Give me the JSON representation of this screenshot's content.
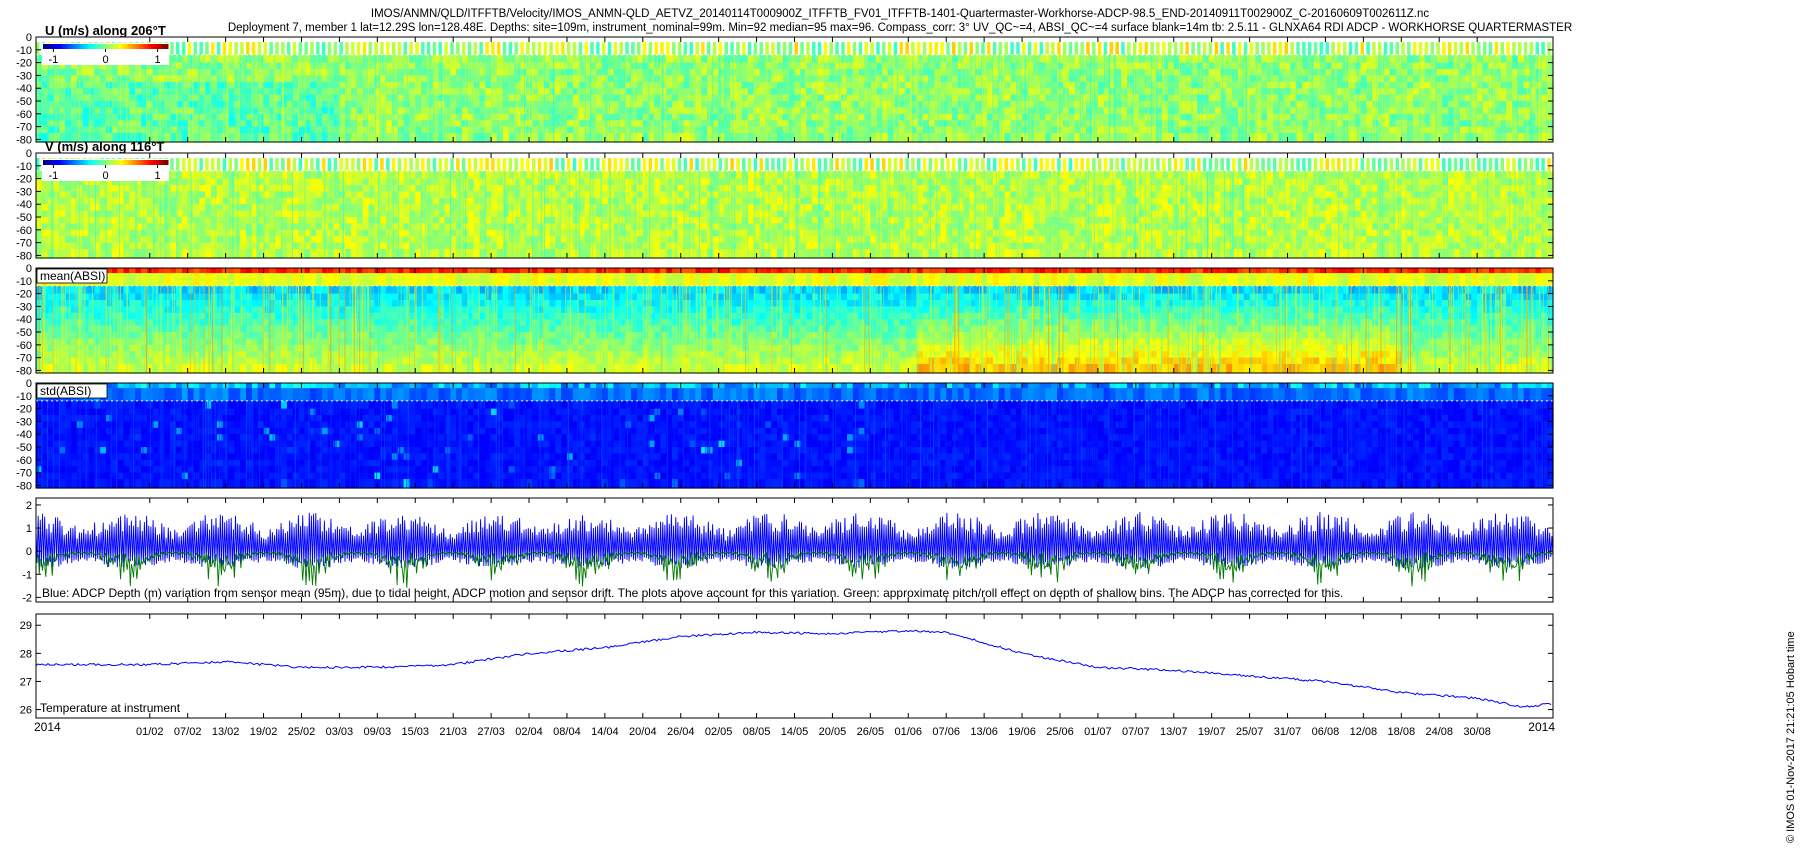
{
  "header": {
    "title_line1": "IMOS/ANMN/QLD/ITFFTB/Velocity/IMOS_ANMN-QLD_AETVZ_20140114T000900Z_ITFFTB_FV01_ITFFTB-1401-Quartermaster-Workhorse-ADCP-98.5_END-20140911T002900Z_C-20160609T002611Z.nc",
    "title_line2": "Deployment 7, member 1 lat=12.29S lon=128.48E. Depths: site=109m, instrument_nominal=99m. Min=92 median=95 max=96. Compass_corr: 3° UV_QC~=4, ABSI_QC~=4 surface blank=14m tb: 2.5.11 - GLNXA64 RDI ADCP - WORKHORSE QUARTERMASTER"
  },
  "side_note": "© IMOS 01-Nov-2017 21:21:05 Hobart time",
  "colors": {
    "axis": "#000000",
    "depth_series": "#0000ff",
    "pitch_series": "#007a00",
    "temperature_series": "#0000ff",
    "blank_line": "#ffffff"
  },
  "chart_data": [
    {
      "type": "heatmap",
      "title": "U (m/s) along 206°T",
      "colorbar": {
        "ticks": [
          "-1",
          "0",
          "1"
        ],
        "range": [
          -1.2,
          1.2
        ]
      },
      "y_ticks": [
        "0",
        "-10",
        "-20",
        "-30",
        "-40",
        "-50",
        "-60",
        "-70",
        "-80"
      ],
      "ylim": [
        -82,
        0
      ],
      "typical_value": 0.0,
      "colormap": "jet"
    },
    {
      "type": "heatmap",
      "title": "V (m/s) along 116°T",
      "colorbar": {
        "ticks": [
          "-1",
          "0",
          "1"
        ],
        "range": [
          -1.2,
          1.2
        ]
      },
      "y_ticks": [
        "0",
        "-10",
        "-20",
        "-30",
        "-40",
        "-50",
        "-60",
        "-70",
        "-80"
      ],
      "ylim": [
        -82,
        0
      ],
      "typical_value": 0.05,
      "colormap": "jet"
    },
    {
      "type": "heatmap",
      "title": "mean(ABSI)",
      "y_ticks": [
        "0",
        "-10",
        "-20",
        "-30",
        "-40",
        "-50",
        "-60",
        "-70",
        "-80"
      ],
      "ylim": [
        -82,
        0
      ],
      "colormap": "jet"
    },
    {
      "type": "heatmap",
      "title": "std(ABSI)",
      "y_ticks": [
        "0",
        "-10",
        "-20",
        "-30",
        "-40",
        "-50",
        "-60",
        "-70",
        "-80"
      ],
      "ylim": [
        -82,
        0
      ],
      "colormap": "jet"
    },
    {
      "type": "line",
      "annotation": "Blue: ADCP Depth (m) variation from sensor mean (95m), due to tidal height, ADCP motion and sensor drift. The plots above account for this variation. Green: approximate pitch/roll effect on depth of shallow bins. The ADCP has corrected for this.",
      "y_ticks": [
        "2",
        "1",
        "0",
        "-1",
        "-2"
      ],
      "ylim": [
        -2.2,
        2.3
      ],
      "series": [
        {
          "name": "Blue: ADCP Depth (m) variation",
          "amplitude": 1.7
        },
        {
          "name": "Green: approximate pitch/roll effect",
          "amplitude": -1.3
        }
      ]
    },
    {
      "type": "line",
      "annotation": "Temperature at instrument",
      "y_ticks": [
        "29",
        "28",
        "27",
        "26"
      ],
      "ylim": [
        25.7,
        29.4
      ],
      "x": [
        "2014-01-14",
        "2014-02-01",
        "2014-02-13",
        "2014-02-25",
        "2014-03-09",
        "2014-03-21",
        "2014-04-02",
        "2014-04-14",
        "2014-04-26",
        "2014-05-08",
        "2014-05-20",
        "2014-06-01",
        "2014-06-07",
        "2014-06-19",
        "2014-07-01",
        "2014-07-13",
        "2014-07-25",
        "2014-08-06",
        "2014-08-18",
        "2014-08-30",
        "2014-09-06",
        "2014-09-11"
      ],
      "values": [
        27.6,
        27.6,
        27.7,
        27.5,
        27.5,
        27.6,
        28.0,
        28.2,
        28.6,
        28.75,
        28.7,
        28.8,
        28.75,
        28.0,
        27.5,
        27.4,
        27.2,
        27.0,
        26.6,
        26.4,
        26.1,
        26.2
      ]
    }
  ],
  "x_axis": {
    "year_left": "2014",
    "year_right": "2014",
    "tick_labels": [
      "01/02",
      "07/02",
      "13/02",
      "19/02",
      "25/02",
      "03/03",
      "09/03",
      "15/03",
      "21/03",
      "27/03",
      "02/04",
      "08/04",
      "14/04",
      "20/04",
      "26/04",
      "02/05",
      "08/05",
      "14/05",
      "20/05",
      "26/05",
      "01/06",
      "07/06",
      "13/06",
      "19/06",
      "25/06",
      "01/07",
      "07/07",
      "13/07",
      "19/07",
      "25/07",
      "31/07",
      "06/08",
      "12/08",
      "18/08",
      "24/08",
      "30/08"
    ]
  }
}
